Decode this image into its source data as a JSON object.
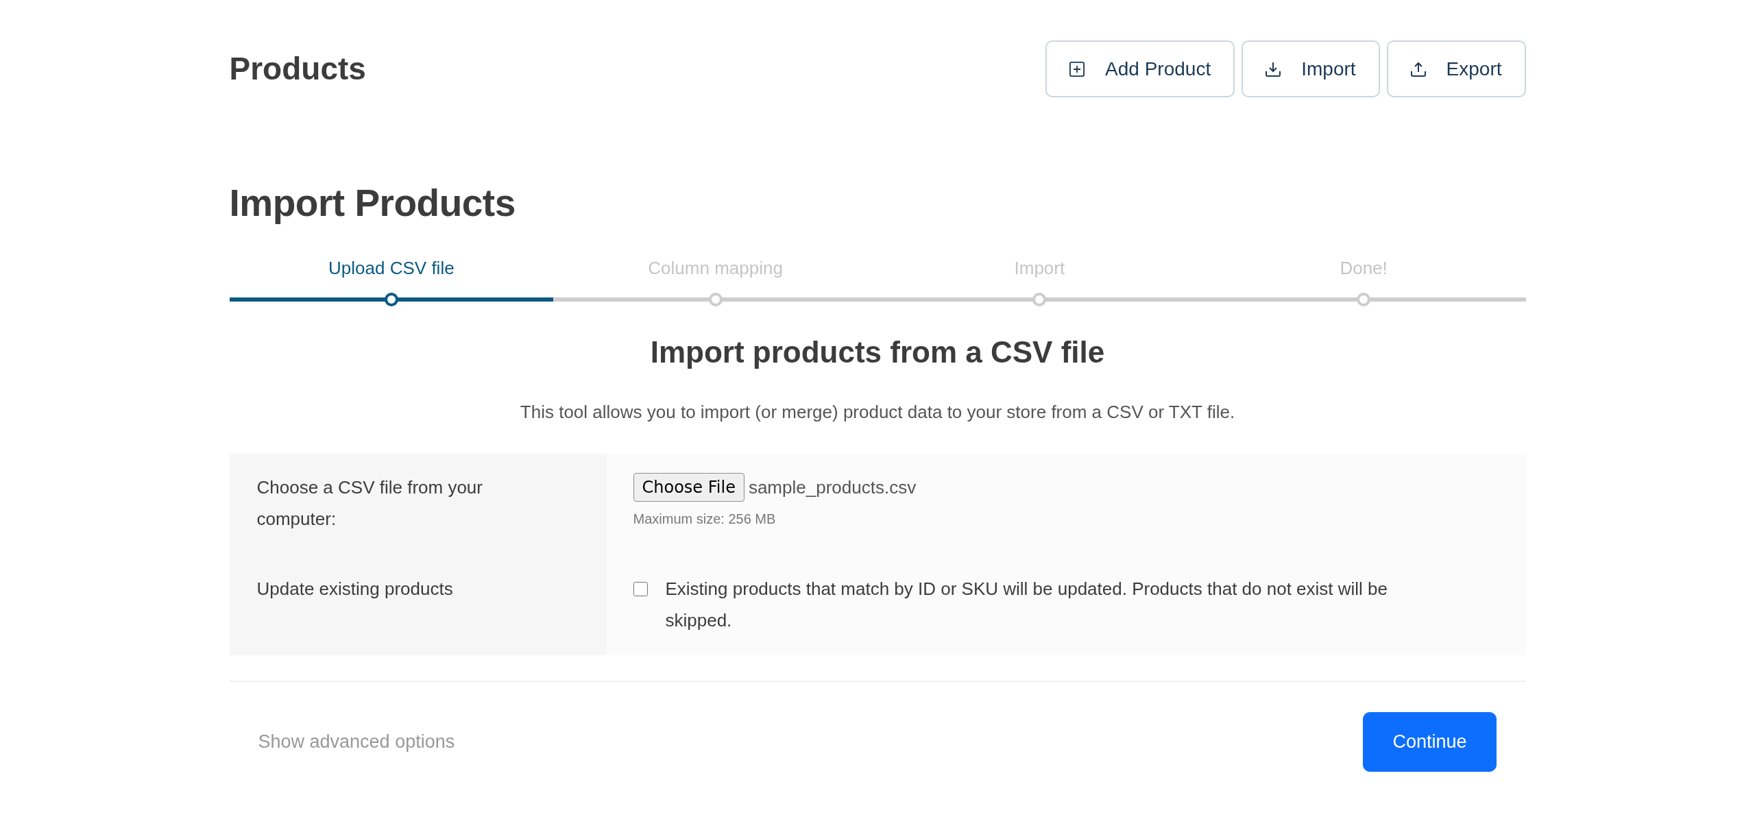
{
  "header": {
    "title": "Products",
    "actions": [
      {
        "kind": "add",
        "label": "Add Product"
      },
      {
        "kind": "import",
        "label": "Import"
      },
      {
        "kind": "export",
        "label": "Export"
      }
    ]
  },
  "section": {
    "title": "Import Products"
  },
  "steps": [
    {
      "label": "Upload CSV file",
      "selected": true
    },
    {
      "label": "Column mapping",
      "selected": false
    },
    {
      "label": "Import",
      "selected": false
    },
    {
      "label": "Done!",
      "selected": false
    }
  ],
  "panel": {
    "heading": "Import products from a CSV file",
    "description": "This tool allows you to import (or merge) product data to your store from a CSV or TXT file."
  },
  "form": {
    "rows": [
      {
        "kind": "file",
        "label": "Choose a CSV file from your computer:",
        "button": "Choose File",
        "value": "sample_products.csv",
        "hint": "Maximum size: 256 MB"
      },
      {
        "kind": "checkbox",
        "label": "Update existing products",
        "checked": false,
        "text": "Existing products that match by ID or SKU will be updated. Products that do not exist will be skipped."
      }
    ]
  },
  "footer": {
    "link": "Show advanced options",
    "button": "Continue"
  }
}
